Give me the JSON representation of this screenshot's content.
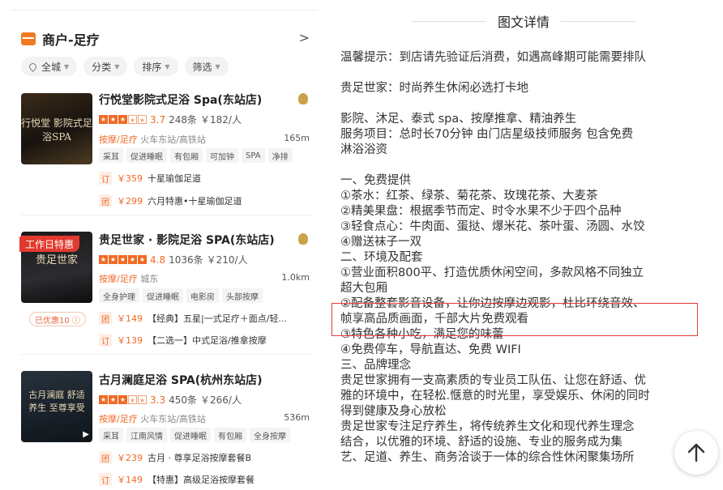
{
  "left": {
    "header": {
      "title": "商户-足疗",
      "chevron": ">"
    },
    "filters": [
      {
        "label": "全城"
      },
      {
        "label": "分类"
      },
      {
        "label": "排序"
      },
      {
        "label": "筛选"
      }
    ],
    "shops": [
      {
        "name": "行悦堂影院式足浴 Spa(东站店)",
        "score": "3.7",
        "reviews": "248条",
        "price": "￥182/人",
        "category": "按摩/足疗",
        "area": "火车东站/高铁站",
        "distance": "165m",
        "tags": [
          "采耳",
          "促进睡眠",
          "有包厢",
          "可加钟",
          "SPA",
          "净排"
        ],
        "thumb_text": "行悦堂 影院式足浴SPA",
        "deals": [
          {
            "icon": "订",
            "price": "￥359",
            "title": "十星瑜伽足道"
          },
          {
            "icon": "团",
            "price": "￥299",
            "title": "六月特惠•十星瑜伽足道"
          }
        ]
      },
      {
        "name": "贵足世家 · 影院足浴 SPA(东站店)",
        "badge": "工作日特惠",
        "score": "4.8",
        "reviews": "1036条",
        "price": "￥210/人",
        "category": "按摩/足疗",
        "area": "城东",
        "distance": "1.0km",
        "tags": [
          "全身护理",
          "促进睡眠",
          "电影房",
          "头部按摩"
        ],
        "thumb_text": "贵足世家",
        "coupon": "已优惠10",
        "deals": [
          {
            "icon": "团",
            "price": "￥149",
            "title": "【经典】五星|一式足疗＋面点/轻..."
          },
          {
            "icon": "订",
            "price": "￥139",
            "title": "【二选一】中式足浴/推拿按摩"
          }
        ]
      },
      {
        "name": "古月澜庭足浴 SPA(杭州东站店)",
        "score": "3.3",
        "reviews": "450条",
        "price": "￥266/人",
        "category": "按摩/足疗",
        "area": "火车东站/高铁站",
        "distance": "536m",
        "tags": [
          "采耳",
          "江南风情",
          "促进睡眠",
          "有包厢",
          "全身按摩"
        ],
        "thumb_text": "古月澜庭 舒适养生 至尊享受",
        "deals": [
          {
            "icon": "团",
            "price": "￥239",
            "title": "古月 · 尊享足浴按摩套餐B"
          },
          {
            "icon": "订",
            "price": "￥149",
            "title": "【特惠】高级足浴按摩套餐"
          }
        ]
      }
    ]
  },
  "right": {
    "title": "图文详情",
    "lines": [
      "温馨提示：到店请先验证后消费，如遇高峰期可能需要排队",
      "",
      "贵足世家：时尚养生休闲必选打卡地",
      "",
      "影院、沐足、泰式 spa、按摩推拿、精油养生",
      "服务项目：总时长70分钟 由门店星级技师服务 包含免费",
      "淋浴浴资",
      "",
      "一、免费提供",
      "①茶水：红茶、绿茶、菊花茶、玫瑰花茶、大麦茶",
      "②精美果盘：根据季节而定、时令水果不少于四个品种",
      "③轻食点心：牛肉面、蛋挞、爆米花、茶叶蛋、汤圆、水饺",
      "④赠送袜子一双",
      "二、环境及配套",
      "①营业面积800平、打造优质休闲空间，多款风格不同独立",
      "超大包厢",
      "②配备整套影音设备，让你边按摩边观影，杜比环绕音效、",
      "帧享高品质画面，千部大片免费观看",
      "③特色各种小吃，满足您的味蕾",
      "④免费停车，导航直达、免费 WIFI",
      "三、品牌理念",
      "贵足世家拥有一支高素质的专业员工队伍、让您在舒适、优",
      "雅的环境中，在轻松.惬意的时光里，享受娱乐、休闲的同时",
      "得到健康及身心放松",
      "贵足世家专注足疗养生，将传统养生文化和现代养生理念",
      "结合，以优雅的环境、舒适的设施、专业的服务成为集",
      "艺、足道、养生、商务洽谈于一体的综合性休闲聚集场所"
    ]
  }
}
